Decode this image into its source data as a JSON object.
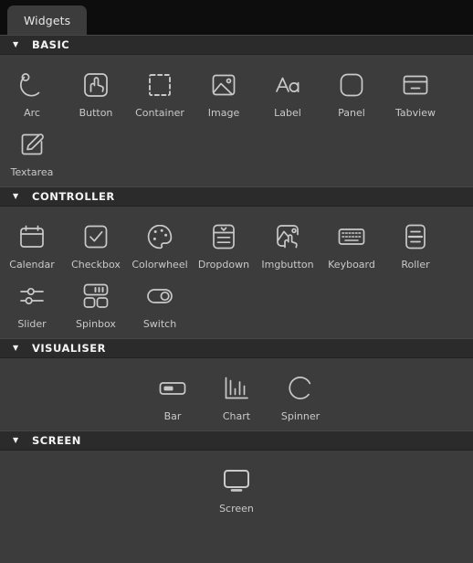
{
  "window": {
    "background": "#0d0d0d",
    "panel_background": "#3c3c3c",
    "header_background": "#2b2b2b",
    "icon_color": "#c9c9c9",
    "label_color": "#c9c9c9"
  },
  "tabs": [
    {
      "label": "Widgets",
      "active": true
    }
  ],
  "sections": [
    {
      "id": "basic",
      "title": "BASIC",
      "caret": "▼",
      "expanded": true,
      "align": "left",
      "items": [
        {
          "label": "Arc",
          "icon": "arc-icon"
        },
        {
          "label": "Button",
          "icon": "button-icon"
        },
        {
          "label": "Container",
          "icon": "container-icon"
        },
        {
          "label": "Image",
          "icon": "image-icon"
        },
        {
          "label": "Label",
          "icon": "label-icon"
        },
        {
          "label": "Panel",
          "icon": "panel-icon"
        },
        {
          "label": "Tabview",
          "icon": "tabview-icon"
        },
        {
          "label": "Textarea",
          "icon": "textarea-icon"
        }
      ]
    },
    {
      "id": "controller",
      "title": "CONTROLLER",
      "caret": "▼",
      "expanded": true,
      "align": "left",
      "items": [
        {
          "label": "Calendar",
          "icon": "calendar-icon"
        },
        {
          "label": "Checkbox",
          "icon": "checkbox-icon"
        },
        {
          "label": "Colorwheel",
          "icon": "colorwheel-icon"
        },
        {
          "label": "Dropdown",
          "icon": "dropdown-icon"
        },
        {
          "label": "Imgbutton",
          "icon": "imgbutton-icon"
        },
        {
          "label": "Keyboard",
          "icon": "keyboard-icon"
        },
        {
          "label": "Roller",
          "icon": "roller-icon"
        },
        {
          "label": "Slider",
          "icon": "slider-icon"
        },
        {
          "label": "Spinbox",
          "icon": "spinbox-icon"
        },
        {
          "label": "Switch",
          "icon": "switch-icon"
        }
      ]
    },
    {
      "id": "visualiser",
      "title": "VISUALISER",
      "caret": "▼",
      "expanded": true,
      "align": "center",
      "items": [
        {
          "label": "Bar",
          "icon": "bar-icon"
        },
        {
          "label": "Chart",
          "icon": "chart-icon"
        },
        {
          "label": "Spinner",
          "icon": "spinner-icon"
        }
      ]
    },
    {
      "id": "screen",
      "title": "SCREEN",
      "caret": "▼",
      "expanded": true,
      "align": "center",
      "items": [
        {
          "label": "Screen",
          "icon": "screen-icon"
        }
      ]
    }
  ]
}
